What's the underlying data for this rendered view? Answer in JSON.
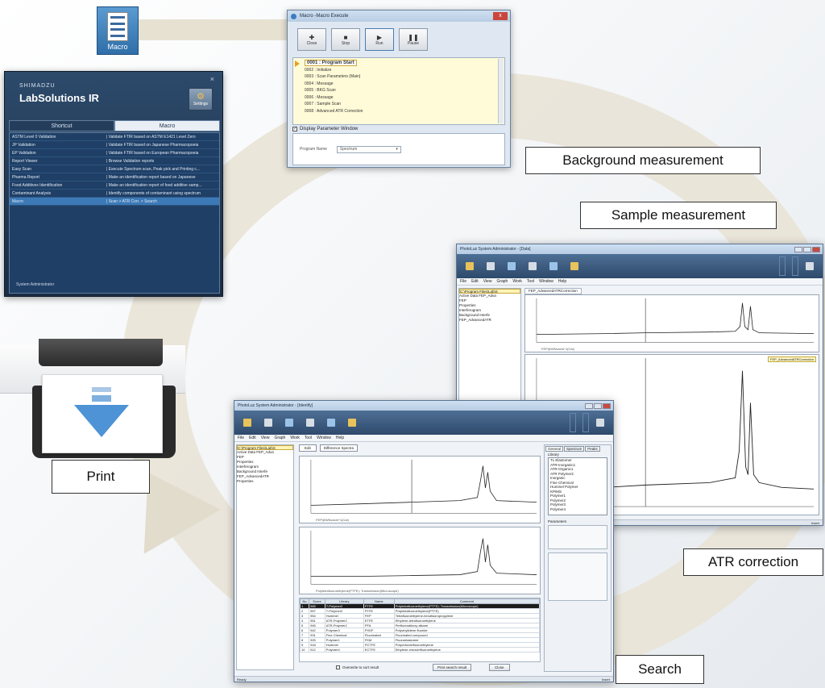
{
  "macro_icon": {
    "label": "Macro"
  },
  "launcher": {
    "brand": "SHIMADZU",
    "title": "LabSolutions IR",
    "close": "×",
    "settings_label": "Settings",
    "tabs": [
      {
        "label": "Shortcut"
      },
      {
        "label": "Macro"
      }
    ],
    "rows": [
      {
        "name": "ASTM Level 0 Validation",
        "desc": "| Validate FTIR based on ASTM E1421 Level Zero"
      },
      {
        "name": "JP Validation",
        "desc": "| Validate FTIR based on Japanese Pharmacopoeia"
      },
      {
        "name": "EP Validation",
        "desc": "| Validate FTIR based on European Pharmacopoeia"
      },
      {
        "name": "Report Viewer",
        "desc": "| Browse Validation reports"
      },
      {
        "name": "Easy Scan",
        "desc": "| Execute Spectrum scan, Peak pick and Printing c..."
      },
      {
        "name": "Pharma Report",
        "desc": "| Make an identification report based on Japanese"
      },
      {
        "name": "Food Additives Identification",
        "desc": "| Make an identification report of food additive samp..."
      },
      {
        "name": "Contaminant Analysis",
        "desc": "| Identify components of contaminant using spectrum"
      },
      {
        "name": "Macro",
        "desc": "| Scan > ATR Corr. > Search"
      }
    ],
    "footer": "System Administrator"
  },
  "macro_window": {
    "title": "Macro -Macro Execute",
    "close": "x",
    "buttons": [
      {
        "label": "Close",
        "symbol": "✚"
      },
      {
        "label": "Stop",
        "symbol": "■"
      },
      {
        "label": "Run",
        "symbol": "▶"
      },
      {
        "label": "Pause",
        "symbol": "❚❚"
      }
    ],
    "current_step": "0001 : Program Start",
    "steps": [
      "0002 : Initialize",
      "0003 : Scan Parameters (Main)",
      "0004 : Message",
      "0005 : BKG Scan",
      "0006 : Message",
      "0007 : Sample Scan",
      "0008 : Advanced ATR Correction"
    ],
    "checkbox_label": "Display Parameter Window",
    "program_name_label": "Program Name",
    "program_name_value": "Spectrum"
  },
  "labels": {
    "background": "Background measurement",
    "sample": "Sample measurement",
    "print": "Print",
    "atr": "ATR correction",
    "search": "Search"
  },
  "atr_window": {
    "title": "PhotoLuz System Administrator - [Data]",
    "menu": [
      "File",
      "Edit",
      "View",
      "Graph",
      "Work",
      "Tool",
      "Window",
      "Help"
    ],
    "tab": "FEP_AdvancedATRCorrection",
    "tree": [
      "C:\\Program Files\\Lab\\S",
      "Active Data FEP_Adva",
      "FEP",
      "Properties",
      "Interferogram",
      "Background Interfe",
      "FEP_AdvancedATR"
    ],
    "top_xlabel": "FEP@WNvacm^1(Cal)",
    "bottom_tag": "FEP_AdvancedATRCorrection",
    "status_right": "Insert"
  },
  "search_window": {
    "title": "PhotoLuz System Administrator - [Identify]",
    "menu": [
      "File",
      "Edit",
      "View",
      "Graph",
      "Work",
      "Tool",
      "Window",
      "Help"
    ],
    "tree": [
      "C:\\Program Files\\Lab\\S",
      "Active Data FEP_Adva",
      "FEP",
      "Properties",
      "Interferogram",
      "Background Interfe",
      "FEP_AdvancedATR",
      "Properties"
    ],
    "top_buttons": [
      "Edit",
      "Difference Spectra"
    ],
    "plot1_xlabel": "FEP@WNvacm^1(Cal)",
    "plot2_xlabel": "Polytetrafluoroethylene(PTFE): Transmission(Microscope)",
    "right_tabs": [
      "General",
      "Spectrum",
      "Peaks"
    ],
    "library_label": "Library",
    "libraries": [
      "TL Elastomer",
      "ATR-Inorganic1",
      "ATR-Organic1",
      "ATR Polymer2",
      "Inorganic",
      "Fine Chemical",
      "Hummel Polymer",
      "KPIMS",
      "Polymer1",
      "Polymer2",
      "Polymer3",
      "Polymer4"
    ],
    "param_label": "Parameters",
    "result_cols": [
      "No",
      "Score",
      "Library",
      "Name",
      "Comment"
    ],
    "results": [
      [
        "1",
        "965",
        "T-Polymer2",
        "PTFE",
        "Polytetrafluoroethylene(PTFE): Transmission(Microscope)"
      ],
      [
        "2",
        "957",
        "T-Polymer2",
        "PTFE",
        "Polytetrafluoroethylene(PTFE)"
      ],
      [
        "3",
        "954",
        "Hummel",
        "FEP",
        "Tetrafluoroethylene-hexafluoropropylene"
      ],
      [
        "4",
        "951",
        "ATR-Polymer2",
        "ETFE",
        "Ethylene-tetrafluoroethylene"
      ],
      [
        "5",
        "945",
        "ATR-Polymer2",
        "PFA",
        "Perfluoroalkoxy alkane"
      ],
      [
        "6",
        "942",
        "Polymer3",
        "PVDF",
        "Polyvinylidene fluoride"
      ],
      [
        "7",
        "931",
        "Fine Chemical",
        "Fluorinated",
        "Fluorinated compound"
      ],
      [
        "8",
        "925",
        "Polymer1",
        "FKM",
        "Fluoroelastomer"
      ],
      [
        "9",
        "918",
        "Hummel",
        "PCTFE",
        "Polychlorotrifluoroethylene"
      ],
      [
        "10",
        "912",
        "Polymer4",
        "ECTFE",
        "Ethylene chlorotrifluoroethylene"
      ]
    ],
    "checkbox": "Overwrite to sort result",
    "save_button": "Print search result",
    "close_button": "Close",
    "status_left": "Ready",
    "status_right": "Insert"
  },
  "colors": {
    "launcher_bg": "#1f3f66",
    "highlight": "#3c79b6",
    "ring": "#e9e3d6",
    "step_bg": "#fffbd8"
  }
}
